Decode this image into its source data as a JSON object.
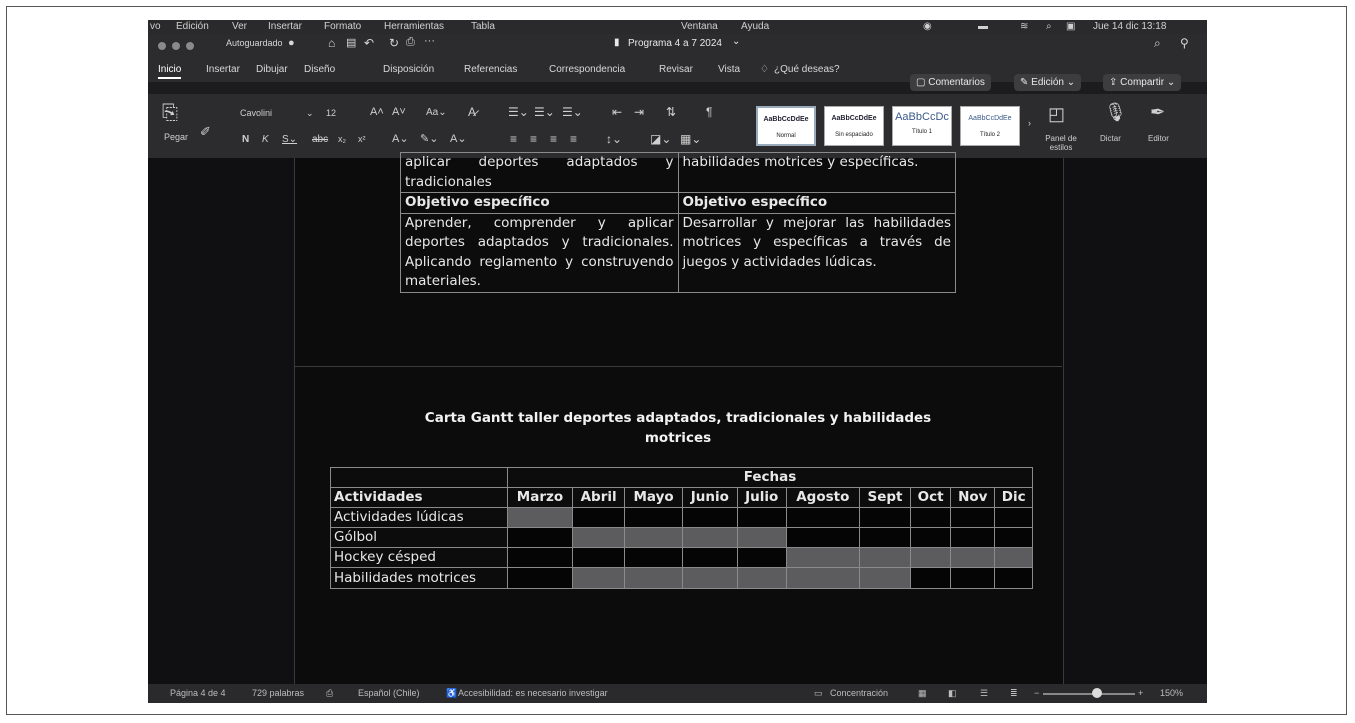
{
  "menubar": {
    "items": [
      "vo",
      "Edición",
      "Ver",
      "Insertar",
      "Formato",
      "Herramientas",
      "Tabla",
      "Ventana",
      "Ayuda"
    ],
    "clock": "Jue 14 dic  13:18"
  },
  "titlebar": {
    "autosave_label": "Autoguardado",
    "document_title": "Programa 4 a 7 2024",
    "tabs": [
      "Inicio",
      "Insertar",
      "Dibujar",
      "Diseño",
      "Disposición",
      "Referencias",
      "Correspondencia",
      "Revisar",
      "Vista"
    ],
    "search_hint": "¿Qué deseas?",
    "comments_button": "Comentarios",
    "edit_button": "Edición",
    "share_button": "Compartir"
  },
  "ribbon": {
    "paste_label": "Pegar",
    "font_name": "Cavolini",
    "font_size": "12",
    "styles": [
      {
        "preview": "AaBbCcDdEe",
        "name": "Normal"
      },
      {
        "preview": "AaBbCcDdEe",
        "name": "Sin espaciado"
      },
      {
        "preview": "AaBbCcDc",
        "name": "Título 1"
      },
      {
        "preview": "AaBbCcDdEe",
        "name": "Título 2"
      }
    ],
    "styles_pane_label": "Panel de estilos",
    "dictate_label": "Dictar",
    "editor_label": "Editor"
  },
  "document": {
    "objectives_table": {
      "top_left": "aplicar deportes adaptados y tradicionales",
      "top_right": "habilidades motrices y específicas.",
      "header_left": "Objetivo específico",
      "header_right": "Objetivo específico",
      "body_left": "Aprender, comprender y aplicar deportes adaptados y tradicionales. Aplicando reglamento y construyendo materiales.",
      "body_right": "Desarrollar y mejorar las habilidades motrices y específicas a través de juegos y actividades lúdicas."
    },
    "gantt_title": "Carta Gantt taller deportes adaptados, tradicionales y habilidades motrices",
    "gantt": {
      "dates_header": "Fechas",
      "activities_header": "Actividades",
      "months": [
        "Marzo",
        "Abril",
        "Mayo",
        "Junio",
        "Julio",
        "Agosto",
        "Sept",
        "Oct",
        "Nov",
        "Dic"
      ],
      "rows": [
        {
          "activity": "Actividades lúdicas",
          "active": [
            true,
            false,
            false,
            false,
            false,
            false,
            false,
            false,
            false,
            false
          ]
        },
        {
          "activity": "Gólbol",
          "active": [
            false,
            true,
            true,
            true,
            true,
            false,
            false,
            false,
            false,
            false
          ]
        },
        {
          "activity": "Hockey césped",
          "active": [
            false,
            false,
            false,
            false,
            false,
            true,
            true,
            true,
            true,
            true
          ]
        },
        {
          "activity": "Habilidades motrices",
          "active": [
            false,
            true,
            true,
            true,
            true,
            true,
            true,
            false,
            false,
            false
          ]
        }
      ]
    }
  },
  "statusbar": {
    "page": "Página 4 de 4",
    "words": "729 palabras",
    "language": "Español (Chile)",
    "accessibility": "Accesibilidad: es necesario investigar",
    "focus": "Concentración",
    "zoom": "150%"
  },
  "colors": {
    "active_cell": "#5c5c5e",
    "inactive_cell": "#050505",
    "document_bg": "#0c0c0d"
  }
}
